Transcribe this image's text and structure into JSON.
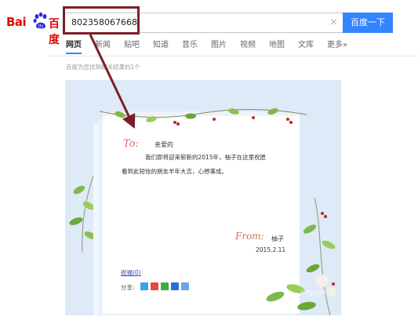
{
  "header": {
    "logo_text_left": "Bai",
    "logo_text_right": "百度",
    "search_value": "802358067668",
    "clear_symbol": "×",
    "search_button_label": "百度一下"
  },
  "tabs": {
    "items": [
      "网页",
      "新闻",
      "贴吧",
      "知道",
      "音乐",
      "图片",
      "视频",
      "地图",
      "文库"
    ],
    "more_label": "更多»"
  },
  "result_count": "百度为您找到相关结果约1个",
  "card": {
    "to_label": "To:",
    "greeting": "亲爱的",
    "message_line1": "我们即将迎来崭新的2015年，柚子在这里祝愿",
    "message_line2": "看到此短信的朋友羊年大吉，心想事成。",
    "from_label": "From:",
    "sender": "柚子",
    "date": "2015.2.11",
    "bless_link": "祝福(0)",
    "share_label": "分享:",
    "share_icons": [
      {
        "name": "qzone-share-icon",
        "color": "#3aa3e3"
      },
      {
        "name": "weibo-share-icon",
        "color": "#e24a3b"
      },
      {
        "name": "wechat-share-icon",
        "color": "#3dae3d"
      },
      {
        "name": "renren-share-icon",
        "color": "#2a6ed1"
      },
      {
        "name": "tencent-share-icon",
        "color": "#6aa7e0"
      }
    ],
    "watermark": "jingyan"
  },
  "colors": {
    "baidu_red": "#e10602",
    "baidu_blue": "#3385ff",
    "highlight": "#7a1f2a"
  }
}
